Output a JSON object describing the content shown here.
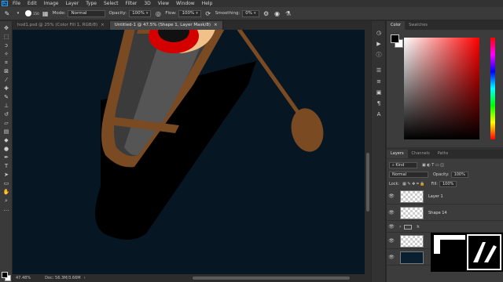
{
  "menu": {
    "logo": "Ps",
    "items": [
      "File",
      "Edit",
      "Image",
      "Layer",
      "Type",
      "Select",
      "Filter",
      "3D",
      "View",
      "Window",
      "Help"
    ]
  },
  "options": {
    "brush_size": "150",
    "mode_label": "Mode:",
    "mode_value": "Normal",
    "opacity_label": "Opacity:",
    "opacity_value": "100%",
    "flow_label": "Flow:",
    "flow_value": "100%",
    "smoothing_label": "Smoothing:",
    "smoothing_value": "0%"
  },
  "tabs": [
    {
      "label": "hod1.psd @ 25% (Color Fill 1, RGB/8)",
      "close": "×"
    },
    {
      "label": "Untitled-1 @ 47.5% (Shape 1, Layer Mask/8)",
      "close": "×"
    }
  ],
  "status": {
    "zoom": "47.48%",
    "doc": "Doc: 56.3M/3.66M"
  },
  "color_panel": {
    "tabs": [
      "Color",
      "Swatches"
    ],
    "fg": "#000000",
    "bg": "#ffffff"
  },
  "layers_panel": {
    "tabs": [
      "Layers",
      "Channels",
      "Paths"
    ],
    "kind_label": "Kind",
    "blend_mode": "Normal",
    "opacity_label": "Opacity:",
    "opacity_value": "100%",
    "lock_label": "Lock:",
    "fill_label": "Fill:",
    "fill_value": "100%",
    "layers": [
      {
        "name": "Layer 1",
        "type": "pixel"
      },
      {
        "name": "Shape 14",
        "type": "shape"
      },
      {
        "name": "h",
        "type": "group"
      },
      {
        "name": "",
        "type": "masked"
      },
      {
        "name": "",
        "type": "fill"
      }
    ]
  },
  "colors": {
    "canvas_bg": "#061623",
    "boat_brown": "#7a4a22",
    "boat_inner": "#3b3b3b",
    "seat": "#555555",
    "paddle": "#7a4a22",
    "shadow": "#000000",
    "red_accent": "#d40000",
    "skin": "#f0c28a"
  }
}
